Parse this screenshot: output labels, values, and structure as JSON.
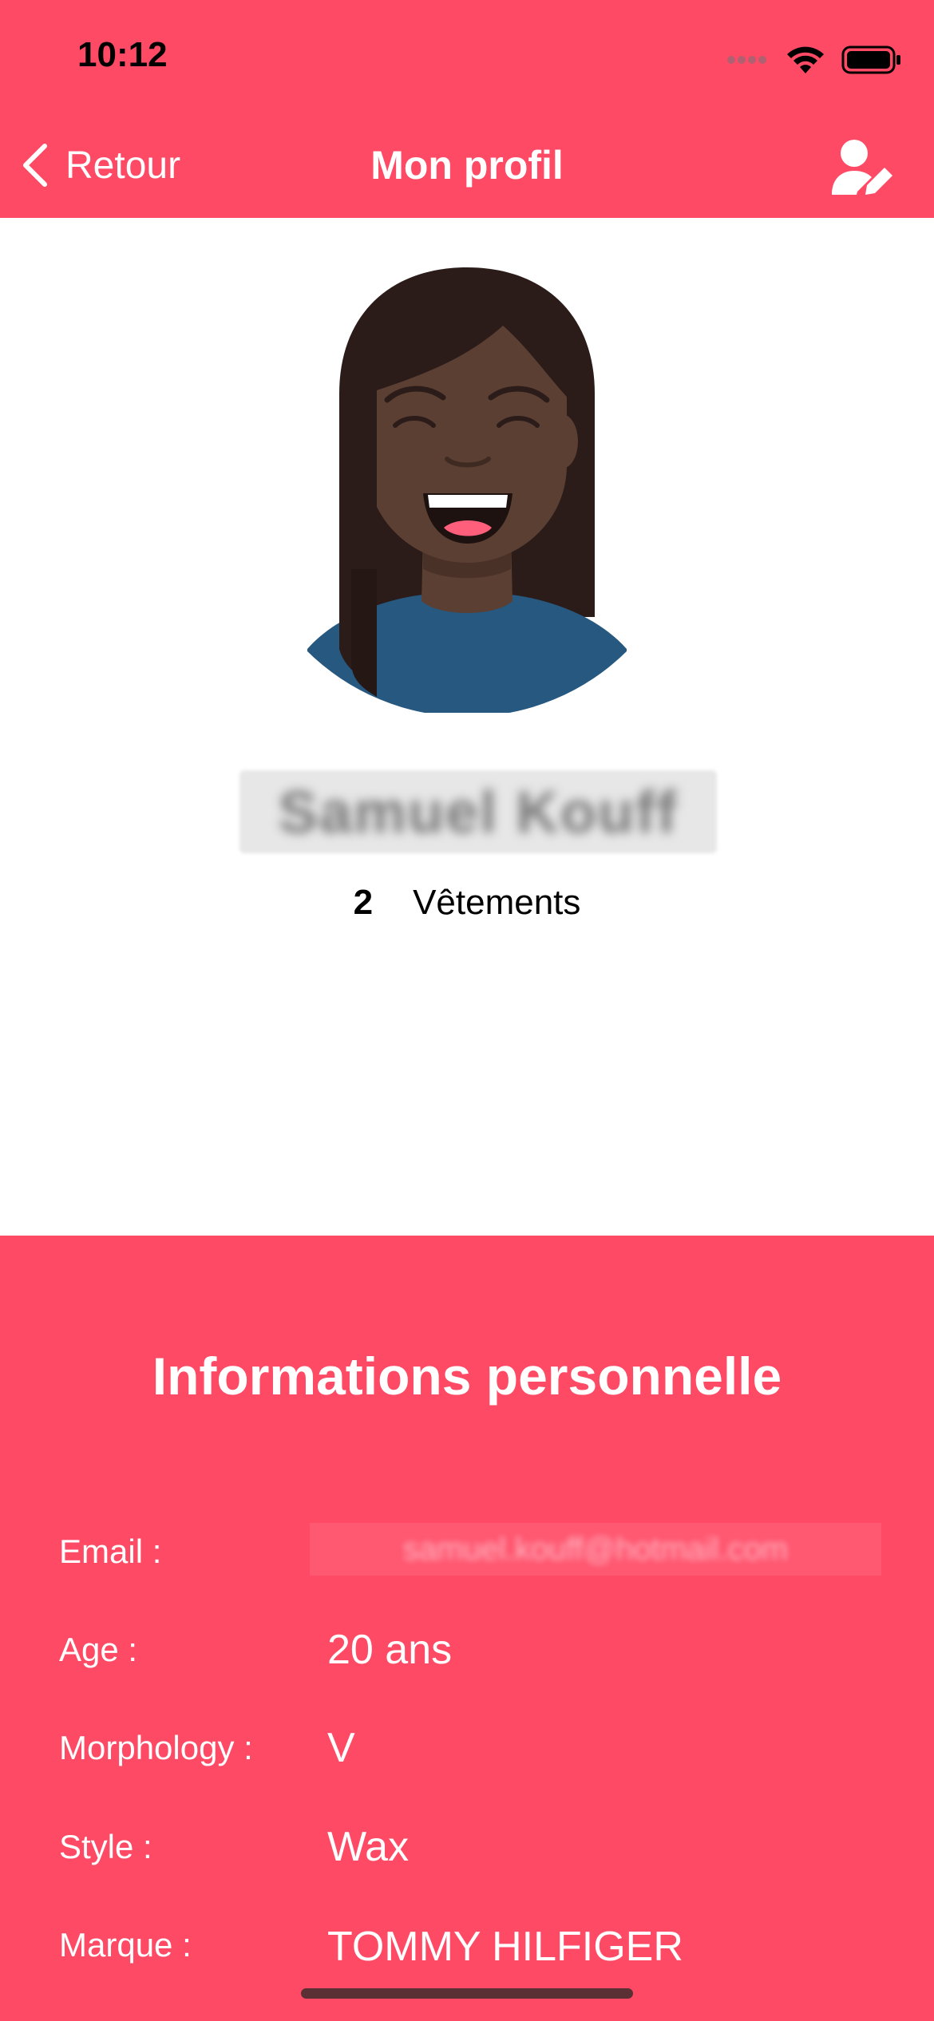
{
  "status_bar": {
    "time": "10:12"
  },
  "nav": {
    "back_label": "Retour",
    "title": "Mon profil",
    "edit_icon": "user-edit-icon"
  },
  "profile": {
    "name": "Samuel Kouff",
    "clothes_count": "2",
    "clothes_label": "Vêtements",
    "colors": {
      "skin": "#5b3f33",
      "hair": "#2b1c1a",
      "shirt": "#27587f"
    }
  },
  "info": {
    "title": "Informations personnelle",
    "rows": [
      {
        "label": "Email :",
        "value": "samuel.kouff@hotmail.com"
      },
      {
        "label": "Age :",
        "value": "20 ans"
      },
      {
        "label": "Morphology :",
        "value": "V"
      },
      {
        "label": "Style :",
        "value": "Wax"
      },
      {
        "label": "Marque :",
        "value": "TOMMY HILFIGER"
      }
    ]
  },
  "colors": {
    "accent": "#ff4a65",
    "background": "#ffffff",
    "text_on_accent": "#ffffff"
  }
}
